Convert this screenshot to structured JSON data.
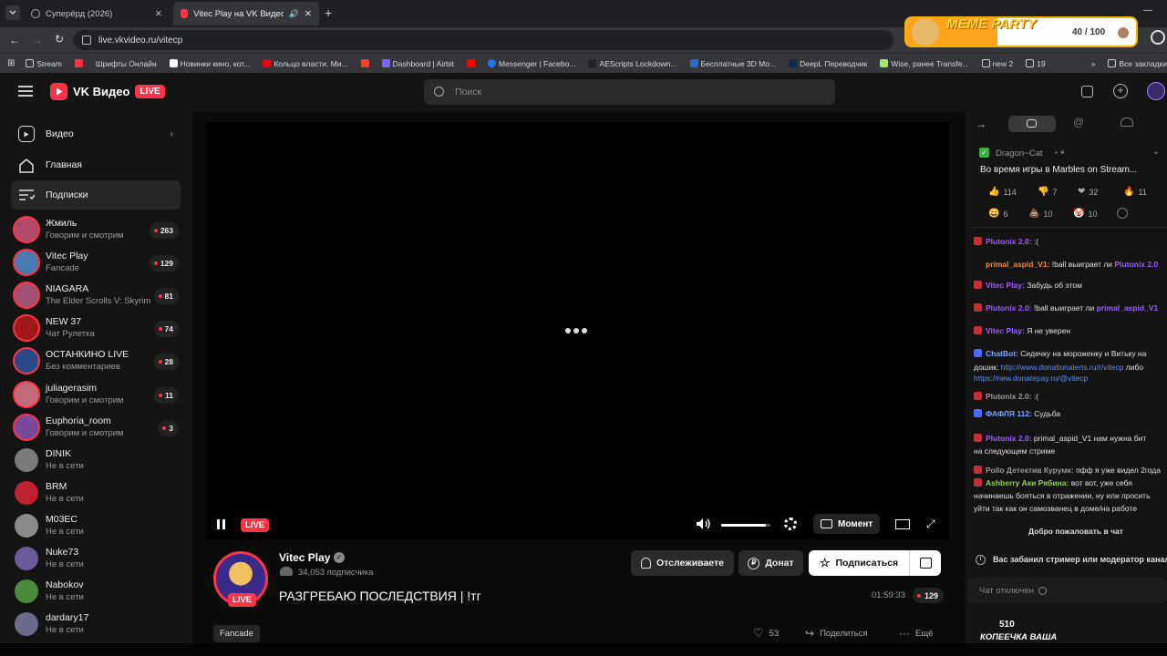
{
  "browser": {
    "tabs": [
      {
        "title": "Суперёрд (2026)"
      },
      {
        "title": "Vitec Play на VK Видео Live"
      }
    ],
    "url": "live.vkvideo.ru/vitecp",
    "bookmarks": [
      "Stream",
      "Шрифты Онлайн",
      "Новинки кино, кот...",
      "Кольцо власти. Ми...",
      "Dashboard | Airbit",
      "Messenger | Facebo...",
      "AEScripts Lockdown...",
      "Бесплатные 3D Мо...",
      "DeepL Переводчик",
      "Wise, ранее Transfe...",
      "new 2",
      "19",
      "Все закладки"
    ]
  },
  "meme_party": {
    "title": "MEME PARTY",
    "progress": "40 / 100"
  },
  "app": {
    "logo_text": "VK Видео",
    "live_tag": "LIVE",
    "search_placeholder": "Поиск"
  },
  "sidebar": {
    "nav": [
      {
        "label": "Видео"
      },
      {
        "label": "Главная"
      },
      {
        "label": "Подписки"
      }
    ],
    "channels": [
      {
        "name": "Жмиль",
        "status": "Говорим и смотрим",
        "viewers": "263",
        "color": "#b04a6a"
      },
      {
        "name": "Vitec Play",
        "status": "Fancade",
        "viewers": "129",
        "color": "#4a7ab0"
      },
      {
        "name": "NIAGARA",
        "status": "The Elder Scrolls V: Skyrim",
        "viewers": "81",
        "color": "#a05070"
      },
      {
        "name": "NEW 37",
        "status": "Чат Рулетка",
        "viewers": "74",
        "color": "#a01818"
      },
      {
        "name": "ОСТАНКИНО LIVE",
        "status": "Без комментариев",
        "viewers": "28",
        "color": "#2a4a8a"
      },
      {
        "name": "juliagerasim",
        "status": "Говорим и смотрим",
        "viewers": "11",
        "color": "#c06a7a"
      },
      {
        "name": "Euphoria_room",
        "status": "Говорим и смотрим",
        "viewers": "3",
        "color": "#7a4a9a"
      },
      {
        "name": "DINIK",
        "status": "Не в сети",
        "viewers": "",
        "color": "#7a7a7a"
      },
      {
        "name": "BRM",
        "status": "Не в сети",
        "viewers": "",
        "color": "#c02030"
      },
      {
        "name": "M03EC",
        "status": "Не в сети",
        "viewers": "",
        "color": "#8a8a8a"
      },
      {
        "name": "Nuke73",
        "status": "Не в сети",
        "viewers": "",
        "color": "#6a5a9a"
      },
      {
        "name": "Nabokov",
        "status": "Не в сети",
        "viewers": "",
        "color": "#4a8a3a"
      },
      {
        "name": "dardary17",
        "status": "Не в сети",
        "viewers": "",
        "color": "#6a6a8a"
      }
    ]
  },
  "player": {
    "live_label": "LIVE",
    "moment_label": "Момент",
    "volume_level": 0.9
  },
  "stream": {
    "channel_name": "Vitec Play",
    "subscribers": "34,053 подписчика",
    "title": "РАЗГРЕБАЮ ПОСЛЕДСТВИЯ | !тг",
    "live_tag": "LIVE",
    "duration": "01:59:33",
    "viewers": "129",
    "category": "Fancade",
    "likes": "53",
    "follow_label": "Отслеживаете",
    "donate_label": "Донат",
    "subscribe_label": "Подписаться",
    "share_label": "Поделиться",
    "more_label": "Ещё"
  },
  "chat": {
    "pinned": {
      "author": "Dragon~Cat",
      "text": "Во время игры в Marbles on Stream...",
      "reactions": [
        {
          "icon": "👍",
          "count": "114"
        },
        {
          "icon": "👎",
          "count": "7"
        },
        {
          "icon": "❤",
          "count": "32"
        },
        {
          "icon": "🔥",
          "count": "11"
        },
        {
          "icon": "😄",
          "count": "6"
        },
        {
          "icon": "💩",
          "count": "10"
        },
        {
          "icon": "🤡",
          "count": "10"
        }
      ]
    },
    "messages": [
      {
        "user": "Plutonix 2.0:",
        "text": ":(",
        "ucls": "u-purple"
      },
      {
        "user": "primal_aspid_V1:",
        "text": "!ball выиграет ли",
        "extra": "Plutonix 2.0",
        "ucls": "u-orange"
      },
      {
        "user": "Vitec Play:",
        "text": "Забудь об этом",
        "ucls": "u-purple"
      },
      {
        "user": "Plutonix 2.0:",
        "text": "!ball выиграет ли",
        "extra": "primal_aspid_V1",
        "ucls": "u-purple"
      },
      {
        "user": "Vitec Play:",
        "text": "Я не уверен",
        "ucls": "u-purple"
      },
      {
        "user": "ChatBot:",
        "text": "Сидечку на мороженку и Витьку на",
        "ucls": "u-blue"
      },
      {
        "line2": "дошик:",
        "link": "http://www.donationalerts.ru/r/vitecp",
        "tail": "либо"
      },
      {
        "line3": "https://new.donatepay.ru/@vitecp"
      },
      {
        "user": "Plutonix 2.0:",
        "text": ":(",
        "ucls": "u-grey"
      },
      {
        "user": "ФАФЛЯ 112:",
        "text": "Судьба",
        "ucls": "u-blue"
      },
      {
        "user": "Plutonix 2.0:",
        "text": "primal_aspid_V1",
        "extra2": "нам нужна бит",
        "ucls": "u-purple"
      },
      {
        "line2": "на следующем стриме"
      },
      {
        "user": "Роllo Детектив Курумк:",
        "text": "пфф я уже видел 2года",
        "ucls": "u-grey"
      },
      {
        "user": "Ashberry Аки Рябина:",
        "text": "вот вот, уже себя",
        "ucls": "u-green"
      },
      {
        "line2": "начинаешь бояться в отражении, ну или просить"
      },
      {
        "line3": "уйти так как он самозванец в доме/на работе"
      }
    ],
    "welcome": "Добро пожаловать в чат",
    "ban_notice": "Вас забанил стример или модератор канала",
    "disabled_text": "Чат отключен",
    "bottom_count": "510",
    "bottom_text": "КОПЕЕЧКА ВАША"
  }
}
